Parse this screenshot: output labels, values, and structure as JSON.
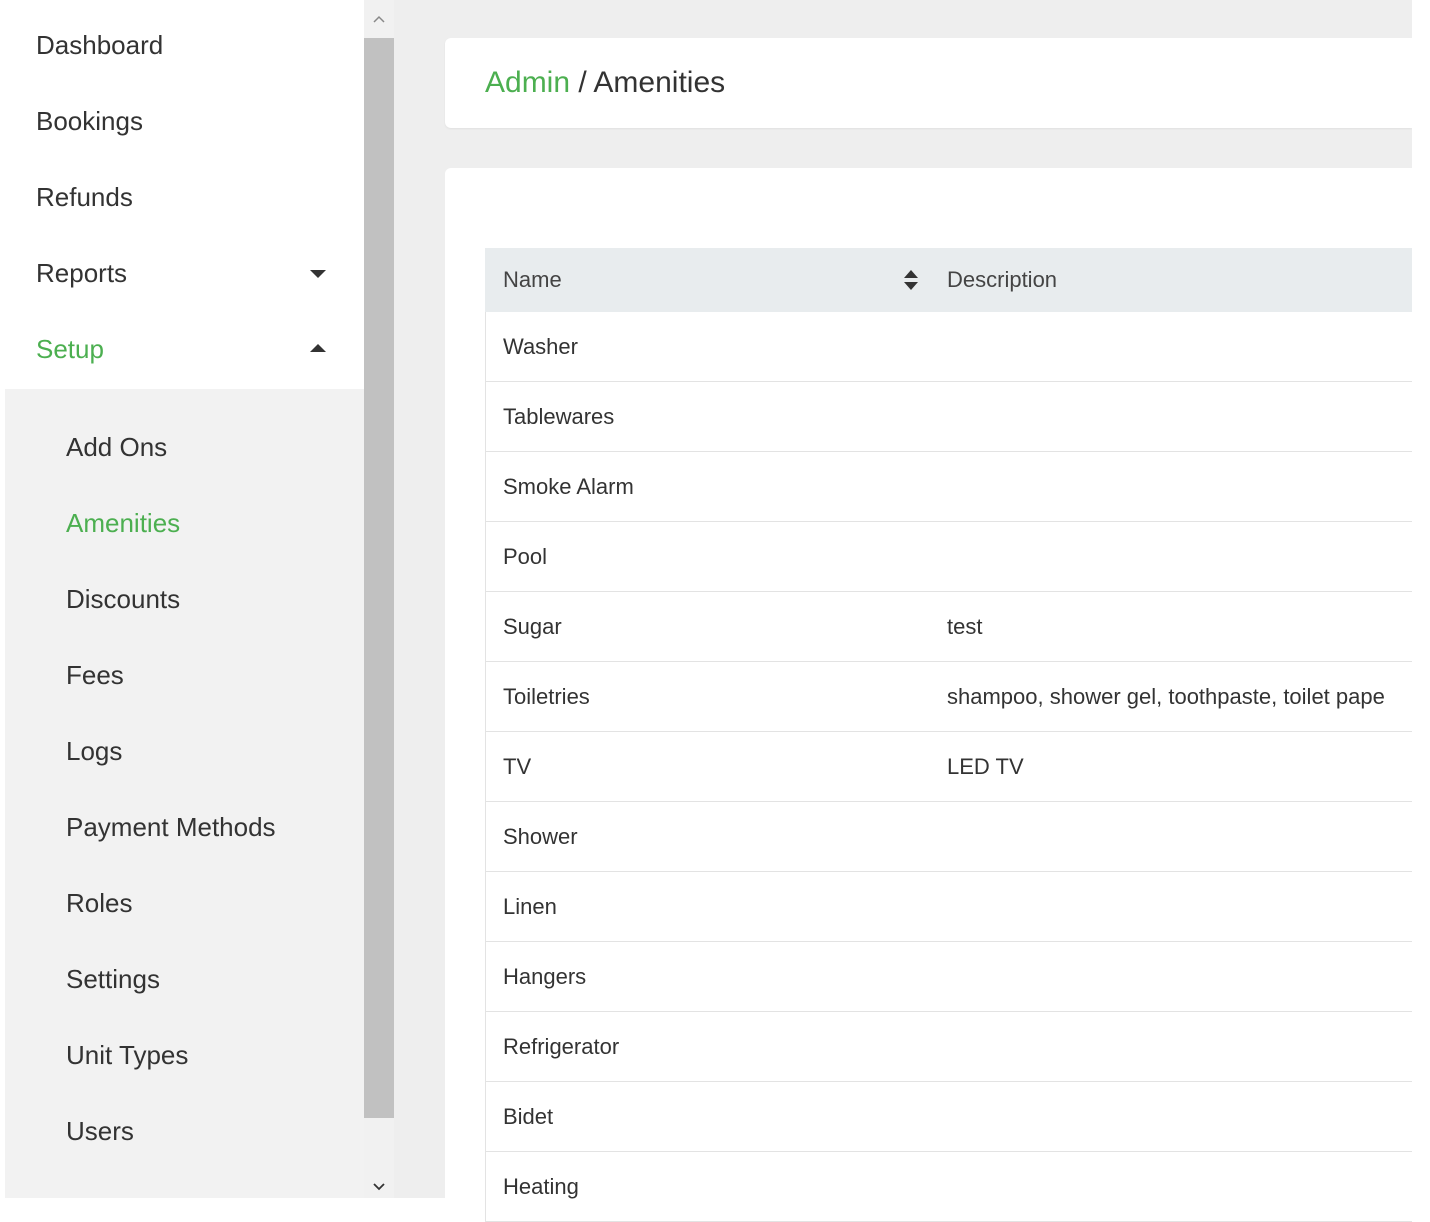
{
  "sidebar": {
    "items": [
      {
        "label": "Dashboard"
      },
      {
        "label": "Bookings"
      },
      {
        "label": "Refunds"
      },
      {
        "label": "Reports"
      },
      {
        "label": "Setup"
      }
    ],
    "submenu": [
      {
        "label": "Add Ons"
      },
      {
        "label": "Amenities"
      },
      {
        "label": "Discounts"
      },
      {
        "label": "Fees"
      },
      {
        "label": "Logs"
      },
      {
        "label": "Payment Methods"
      },
      {
        "label": "Roles"
      },
      {
        "label": "Settings"
      },
      {
        "label": "Unit Types"
      },
      {
        "label": "Users"
      }
    ]
  },
  "breadcrumb": {
    "root": "Admin",
    "separator": " / ",
    "current": "Amenities"
  },
  "table": {
    "headers": {
      "name": "Name",
      "description": "Description"
    },
    "rows": [
      {
        "name": "Washer",
        "description": ""
      },
      {
        "name": "Tablewares",
        "description": ""
      },
      {
        "name": "Smoke Alarm",
        "description": ""
      },
      {
        "name": "Pool",
        "description": ""
      },
      {
        "name": "Sugar",
        "description": "test"
      },
      {
        "name": "Toiletries",
        "description": "shampoo, shower gel, toothpaste, toilet pape"
      },
      {
        "name": "TV",
        "description": "LED TV"
      },
      {
        "name": "Shower",
        "description": ""
      },
      {
        "name": "Linen",
        "description": ""
      },
      {
        "name": "Hangers",
        "description": ""
      },
      {
        "name": "Refrigerator",
        "description": ""
      },
      {
        "name": "Bidet",
        "description": ""
      },
      {
        "name": "Heating",
        "description": ""
      }
    ]
  },
  "colors": {
    "accent": "#4caf50",
    "header_bg": "#e8ecee",
    "submenu_bg": "#f2f2f2"
  },
  "icons": {
    "reports_caret": "caret-down-icon",
    "setup_caret": "caret-up-icon",
    "sort": "sort-icon"
  }
}
